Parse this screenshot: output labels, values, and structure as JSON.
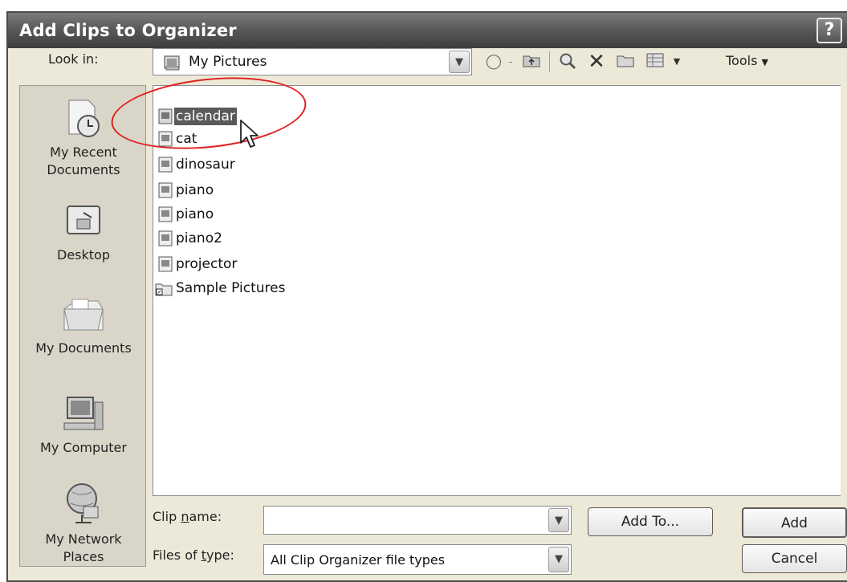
{
  "window": {
    "title": "Add Clips to Organizer",
    "help_label": "?"
  },
  "toolbar": {
    "look_in_label": "Look in:",
    "look_in_value": "My Pictures",
    "tools_label": "Tools"
  },
  "places": [
    {
      "label": "My Recent Documents",
      "icon": "recent-documents-icon"
    },
    {
      "label": "Desktop",
      "icon": "desktop-icon"
    },
    {
      "label": "My Documents",
      "icon": "my-documents-icon"
    },
    {
      "label": "My Computer",
      "icon": "my-computer-icon"
    },
    {
      "label": "My Network Places",
      "icon": "network-places-icon"
    }
  ],
  "files": [
    {
      "name": "calendar",
      "type": "image",
      "selected": true
    },
    {
      "name": "cat",
      "type": "image"
    },
    {
      "name": "dinosaur",
      "type": "image"
    },
    {
      "name": "piano",
      "type": "image"
    },
    {
      "name": "piano",
      "type": "image"
    },
    {
      "name": "piano2",
      "type": "image"
    },
    {
      "name": "projector",
      "type": "image"
    },
    {
      "name": "Sample Pictures",
      "type": "folder-shortcut"
    }
  ],
  "form": {
    "clip_name_label_pre": "Clip ",
    "clip_name_label_key": "n",
    "clip_name_label_post": "ame:",
    "clip_name_value": "",
    "files_of_type_label_pre": "Files of ",
    "files_of_type_label_key": "t",
    "files_of_type_label_post": "ype:",
    "files_of_type_value": "All Clip Organizer file types"
  },
  "buttons": {
    "add_to_label": "Add To...",
    "add_label": "Add",
    "cancel_label": "Cancel"
  },
  "colors": {
    "annotation": "#e02020",
    "selection": "#5a5a5a"
  }
}
